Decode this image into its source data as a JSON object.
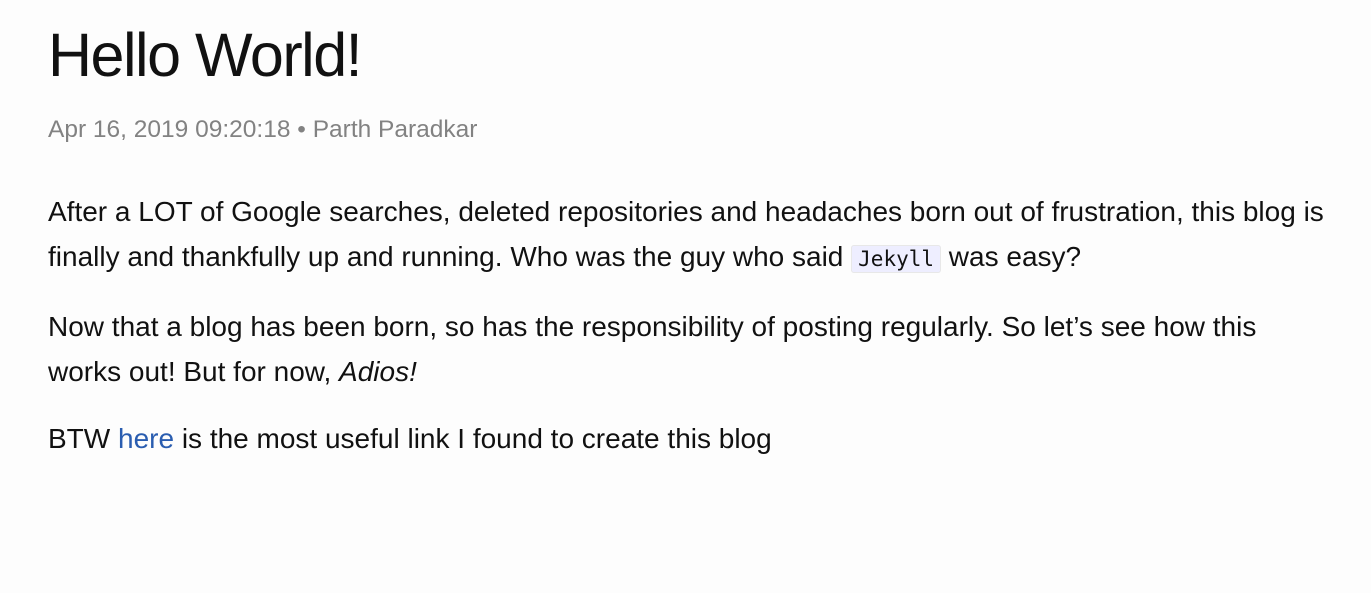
{
  "post": {
    "title": "Hello World!",
    "date": "Apr 16, 2019 09:20:18",
    "separator": " • ",
    "author": "Parth Paradkar",
    "p1": {
      "before_code": "After a LOT of Google searches, deleted repositories and headaches born out of frustration, this blog is finally and thankfully up and running. Who was the guy who said ",
      "code": "Jekyll",
      "after_code": " was easy?"
    },
    "p2": {
      "text": "Now that a blog has been born, so has the responsibility of posting regularly. So let’s see how this works out! But for now, ",
      "emphasis": "Adios!"
    },
    "p3": {
      "before_link": "BTW ",
      "link_text": "here",
      "after_link": " is the most useful link I found to create this blog"
    }
  }
}
